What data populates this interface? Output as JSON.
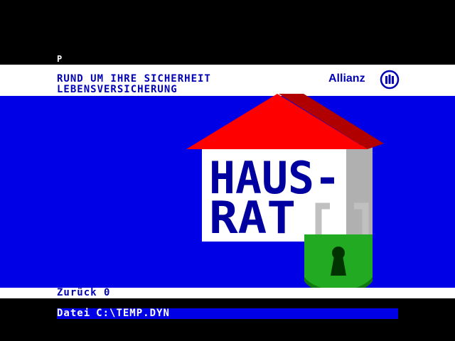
{
  "page_marker": "P",
  "header": {
    "line1": "RUND UM IHRE SICHERHEIT",
    "line2": "LEBENSVERSICHERUNG",
    "brand": "Allianz"
  },
  "illustration": {
    "line1": "HAUS-",
    "line2": "RAT"
  },
  "nav": {
    "back_label": "Zurück 0"
  },
  "file": {
    "label": "Datei",
    "path": "C:\\TEMP.DYN"
  },
  "colors": {
    "background": "#0000e6",
    "text_blue": "#0000b4",
    "roof": "#ff0000",
    "lock": "#22aa22"
  }
}
